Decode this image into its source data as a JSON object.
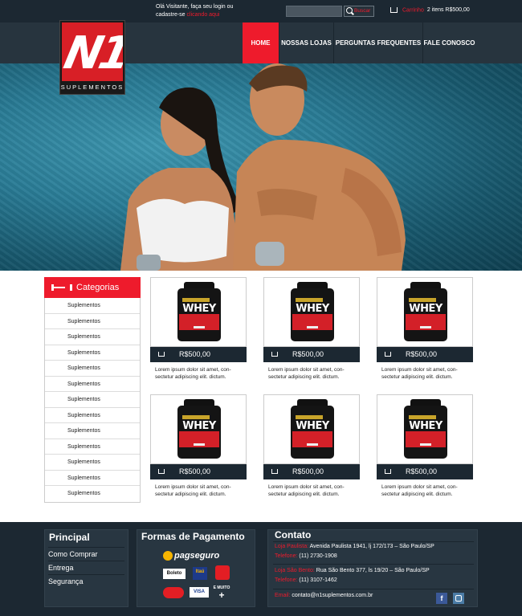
{
  "header": {
    "welcome_line1": "Olá Visitante, faça seu login ou",
    "welcome_line2": "cadastre-se",
    "welcome_link": "clicando aqui",
    "search_button": "Buscar",
    "cart_label": "Carrinho",
    "cart_info": "2 itens R$500,00"
  },
  "logo": {
    "mark": "N1",
    "subtitle": "SUPLEMENTOS"
  },
  "nav": {
    "items": [
      "HOME",
      "NOSSAS LOJAS",
      "PERGUNTAS FREQUENTES",
      "FALE CONOSCO"
    ],
    "active": "HOME"
  },
  "sidebar": {
    "title": "Categorias",
    "items": [
      "Suplementos",
      "Suplementos",
      "Suplementos",
      "Suplementos",
      "Suplementos",
      "Suplementos",
      "Suplementos",
      "Suplementos",
      "Suplementos",
      "Suplementos",
      "Suplementos",
      "Suplementos",
      "Suplementos"
    ]
  },
  "products": [
    {
      "price": "R$500,00",
      "desc1": "Lorem ipsum dolor sit amet, con-",
      "desc2": "sectetur adipiscing elit. dictum.",
      "label": "WHEY",
      "brand": "GOLD STANDARD"
    },
    {
      "price": "R$500,00",
      "desc1": "Lorem ipsum dolor sit amet, con-",
      "desc2": "sectetur adipiscing elit. dictum.",
      "label": "WHEY",
      "brand": "GOLD STANDARD"
    },
    {
      "price": "R$500,00",
      "desc1": "Lorem ipsum dolor sit amet, con-",
      "desc2": "sectetur adipiscing elit. dictum.",
      "label": "WHEY",
      "brand": "GOLD STANDARD"
    },
    {
      "price": "R$500,00",
      "desc1": "Lorem ipsum dolor sit amet, con-",
      "desc2": "sectetur adipiscing elit. dictum.",
      "label": "WHEY",
      "brand": "GOLD STANDARD"
    },
    {
      "price": "R$500,00",
      "desc1": "Lorem ipsum dolor sit amet, con-",
      "desc2": "sectetur adipiscing elit. dictum.",
      "label": "WHEY",
      "brand": "GOLD STANDARD"
    },
    {
      "price": "R$500,00",
      "desc1": "Lorem ipsum dolor sit amet, con-",
      "desc2": "sectetur adipiscing elit. dictum.",
      "label": "WHEY",
      "brand": "GOLD STANDARD"
    }
  ],
  "footer": {
    "principal": {
      "title": "Principal",
      "links": [
        "Como Comprar",
        "Entrega",
        "Segurança"
      ]
    },
    "pagamento": {
      "title": "Formas de Pagamento",
      "pagseguro": "pagseguro",
      "boleto": "Boleto",
      "itau": "Itaú",
      "visa": "VISA",
      "emuito": "E MUITO",
      "plus": "+"
    },
    "contato": {
      "title": "Contato",
      "loja1_label": "Loja Paulista:",
      "loja1_addr": "Avenida Paulista 1941, lj 172/173 – São Paulo/SP",
      "tel_label": "Telefone:",
      "tel1": "(11) 2730-1908",
      "loja2_label": "Loja São Bento:",
      "loja2_addr": "Rua São Bento 377, ls 19/20 – São Paulo/SP",
      "tel2": "(11) 3107-1462",
      "email_label": "Email:",
      "email": "contato@n1suplementos.com.br",
      "facebook": "f"
    }
  },
  "colors": {
    "accent": "#ee1b2c",
    "dark": "#1c2832",
    "panel": "#283641"
  }
}
